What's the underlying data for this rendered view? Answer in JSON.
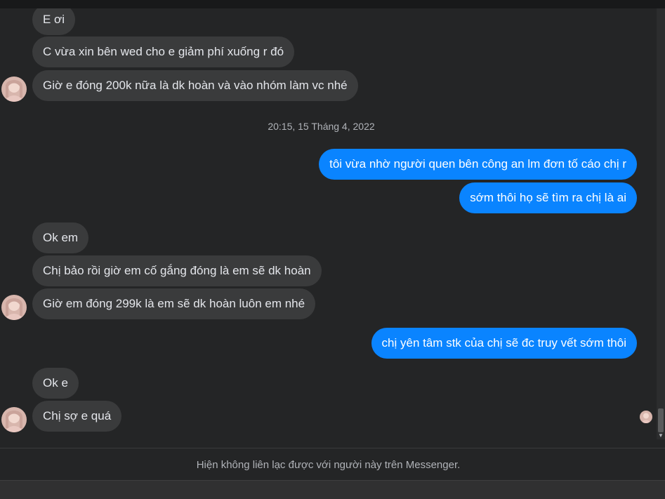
{
  "conversation": {
    "messages": [
      {
        "side": "incoming",
        "text": "E ơi"
      },
      {
        "side": "incoming",
        "text": "C vừa xin bên wed cho e giảm phí xuống r đó"
      },
      {
        "side": "incoming",
        "text": "Giờ e đóng 200k nữa là dk hoàn và vào nhóm làm vc nhé"
      },
      {
        "side": "outgoing",
        "text": "tôi vừa nhờ người quen bên công an lm đơn tố cáo chị r"
      },
      {
        "side": "outgoing",
        "text": "sớm thôi họ sẽ tìm ra chị là ai"
      },
      {
        "side": "incoming",
        "text": "Ok em"
      },
      {
        "side": "incoming",
        "text": "Chị bảo rồi giờ em cố gắng đóng là em sẽ dk hoàn"
      },
      {
        "side": "incoming",
        "text": "Giờ em đóng 299k là em sẽ dk hoàn luôn em nhé"
      },
      {
        "side": "outgoing",
        "text": "chị yên tâm stk của chị sẽ đc truy vết sớm thôi"
      },
      {
        "side": "incoming",
        "text": "Ok e"
      },
      {
        "side": "incoming",
        "text": "Chị sợ e quá"
      }
    ],
    "timestamp": "20:15, 15 Tháng 4, 2022",
    "footer_notice": "Hiện không liên lạc được với người này trên Messenger."
  },
  "colors": {
    "background": "#242526",
    "incoming_bubble": "#3a3b3c",
    "outgoing_bubble": "#0a84ff",
    "muted_text": "#b0b3b8"
  },
  "icons": {
    "contact_avatar": "profile-photo",
    "seen_indicator": "seen-avatar",
    "scroll_down": "chevron-down-icon"
  }
}
